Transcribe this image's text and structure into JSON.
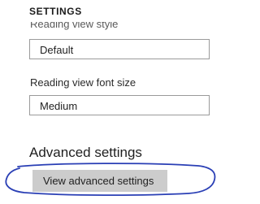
{
  "panel": {
    "title": "SETTINGS"
  },
  "reading_view_style": {
    "label_clipped": "Reading view style",
    "value": "Default"
  },
  "reading_view_font_size": {
    "label": "Reading view font size",
    "value": "Medium"
  },
  "advanced": {
    "heading": "Advanced settings",
    "button_label": "View advanced settings"
  },
  "colors": {
    "button_background": "#cccccc",
    "annotation_stroke": "#2a3fb5",
    "select_border": "#9a9a9a"
  }
}
